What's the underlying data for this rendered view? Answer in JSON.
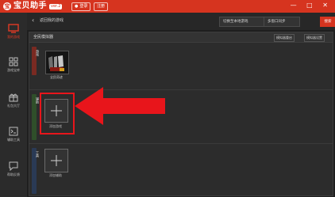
{
  "titlebar": {
    "logo_glyph": "宝",
    "app_title": "宝贝助手",
    "version": "ver.2",
    "login_label": "登录",
    "register_label": "注册",
    "window_controls": "— □ ✕"
  },
  "sidebar": {
    "items": [
      {
        "label": "我的游戏",
        "icon": "monitor-icon",
        "active": true
      },
      {
        "label": "游戏宝库",
        "icon": "grid-icon",
        "active": false
      },
      {
        "label": "礼包大厅",
        "icon": "gift-icon",
        "active": false
      },
      {
        "label": "辅助工具",
        "icon": "terminal-icon",
        "active": false
      },
      {
        "label": "帮助反馈",
        "icon": "chat-icon",
        "active": false
      }
    ]
  },
  "header": {
    "back_icon": "‹",
    "breadcrumb": "返回我的游戏",
    "button_one": "切换至本地游戏",
    "button_two": "多窗口同步",
    "button_red": "搜索"
  },
  "panel": {
    "title": "全民模拟器",
    "btn_a": "模拟器重启",
    "btn_b": "模拟器设置"
  },
  "rows": [
    {
      "tag": "游戏"
    },
    {
      "tag": "辅助"
    },
    {
      "tag": "工具"
    }
  ],
  "game": {
    "name": "全民奇迹"
  },
  "add_tiles": [
    {
      "label": "添加游戏"
    },
    {
      "label": "添加辅助"
    }
  ],
  "colors": {
    "brand": "#d6341f",
    "highlight": "#e8151b"
  }
}
